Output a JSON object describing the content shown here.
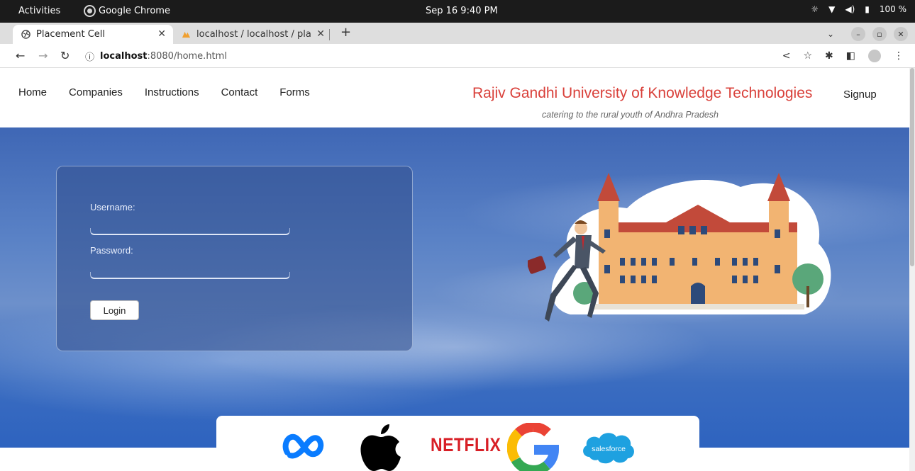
{
  "os_bar": {
    "activities": "Activities",
    "app_name": "Google Chrome",
    "clock": "Sep 16  9:40 PM",
    "battery": "100 %"
  },
  "tabs": [
    {
      "title": "Placement Cell",
      "active": true
    },
    {
      "title": "localhost / localhost / pla",
      "active": false
    }
  ],
  "address_bar": {
    "host": "localhost",
    "path": ":8080/home.html"
  },
  "site": {
    "nav": [
      "Home",
      "Companies",
      "Instructions",
      "Contact",
      "Forms"
    ],
    "brand": "Rajiv Gandhi University of Knowledge Technologies",
    "tagline": "catering to the rural youth of Andhra Pradesh",
    "signup": "Signup"
  },
  "login": {
    "username_label": "Username:",
    "password_label": "Password:",
    "button": "Login"
  },
  "logos": {
    "netflix": "NETFLIX",
    "salesforce": "salesforce"
  },
  "colors": {
    "brand_red": "#d9403a",
    "meta_blue": "#0a7cff",
    "netflix_red": "#d81f26",
    "salesforce_blue": "#1ea1e0"
  },
  "icons": [
    "chrome-icon",
    "globe-icon",
    "phpmyadmin-icon",
    "back-arrow-icon",
    "forward-arrow-icon",
    "reload-icon",
    "info-icon",
    "share-icon",
    "star-icon",
    "extensions-icon",
    "sidepanel-icon",
    "profile-icon",
    "menu-icon",
    "meta-logo",
    "apple-logo",
    "google-logo",
    "salesforce-logo"
  ]
}
